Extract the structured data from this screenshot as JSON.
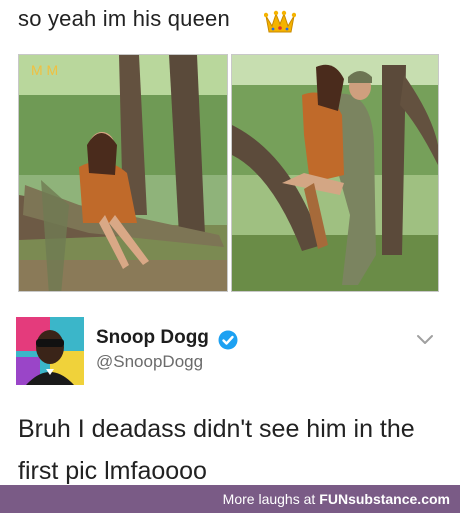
{
  "post": {
    "caption": "so yeah im his queen",
    "caption_icon": "crown-icon"
  },
  "photos": {
    "left_icon": "couple-photo-image",
    "right_icon": "embrace-photo-image"
  },
  "tweet": {
    "author_name": "Snoop Dogg",
    "handle": "@SnoopDogg",
    "verified_icon": "verified-badge-icon",
    "menu_icon": "chevron-down-icon",
    "text": "Bruh I deadass didn't see him in the first pic lmfaoooo"
  },
  "footer": {
    "prefix": "More laughs at",
    "brand_bold": "FUN",
    "brand_rest": "substance.com",
    "background": "#7a5b86"
  },
  "colors": {
    "verified_blue": "#1da1f2",
    "crown_gold": "#f5b300"
  }
}
